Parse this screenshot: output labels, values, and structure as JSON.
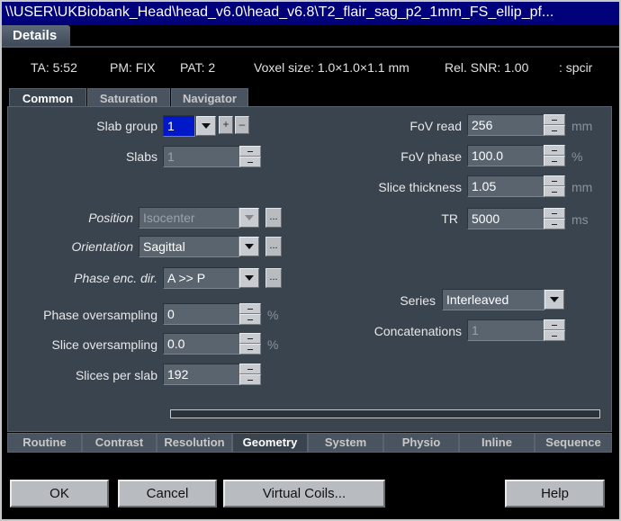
{
  "window": {
    "title": "\\\\USER\\UKBiobank_Head\\head_v6.0\\head_v6.8\\T2_flair_sag_p2_1mm_FS_ellip_pf..."
  },
  "main_tab": "Details",
  "info": {
    "ta": "TA: 5:52",
    "pm": "PM: FIX",
    "pat": "PAT: 2",
    "voxel": "Voxel size: 1.0×1.0×1.1 mm",
    "snr": "Rel. SNR: 1.00",
    "seq": ": spcir"
  },
  "subtabs": [
    "Common",
    "Saturation",
    "Navigator"
  ],
  "left": {
    "slab_group": {
      "label": "Slab group",
      "value": "1",
      "plus": "+",
      "minus": "–"
    },
    "slabs": {
      "label": "Slabs",
      "value": "1"
    },
    "position": {
      "label": "Position",
      "value": "Isocenter",
      "dots": "..."
    },
    "orientation": {
      "label": "Orientation",
      "value": "Sagittal",
      "dots": "..."
    },
    "phase_enc_dir": {
      "label": "Phase enc. dir.",
      "value": "A >> P",
      "dots": "..."
    },
    "phase_oversampling": {
      "label": "Phase oversampling",
      "value": "0",
      "unit": "%"
    },
    "slice_oversampling": {
      "label": "Slice oversampling",
      "value": "0.0",
      "unit": "%"
    },
    "slices_per_slab": {
      "label": "Slices per slab",
      "value": "192"
    }
  },
  "right": {
    "fov_read": {
      "label": "FoV read",
      "value": "256",
      "unit": "mm"
    },
    "fov_phase": {
      "label": "FoV phase",
      "value": "100.0",
      "unit": "%"
    },
    "slice_thickness": {
      "label": "Slice thickness",
      "value": "1.05",
      "unit": "mm"
    },
    "tr": {
      "label": "TR",
      "value": "5000",
      "unit": "ms"
    },
    "series": {
      "label": "Series",
      "value": "Interleaved"
    },
    "concatenations": {
      "label": "Concatenations",
      "value": "1"
    }
  },
  "bottom_tabs": [
    "Routine",
    "Contrast",
    "Resolution",
    "Geometry",
    "System",
    "Physio",
    "Inline",
    "Sequence"
  ],
  "active_bottom_tab": "Geometry",
  "buttons": {
    "ok": "OK",
    "cancel": "Cancel",
    "virtual_coils": "Virtual Coils...",
    "help": "Help"
  }
}
